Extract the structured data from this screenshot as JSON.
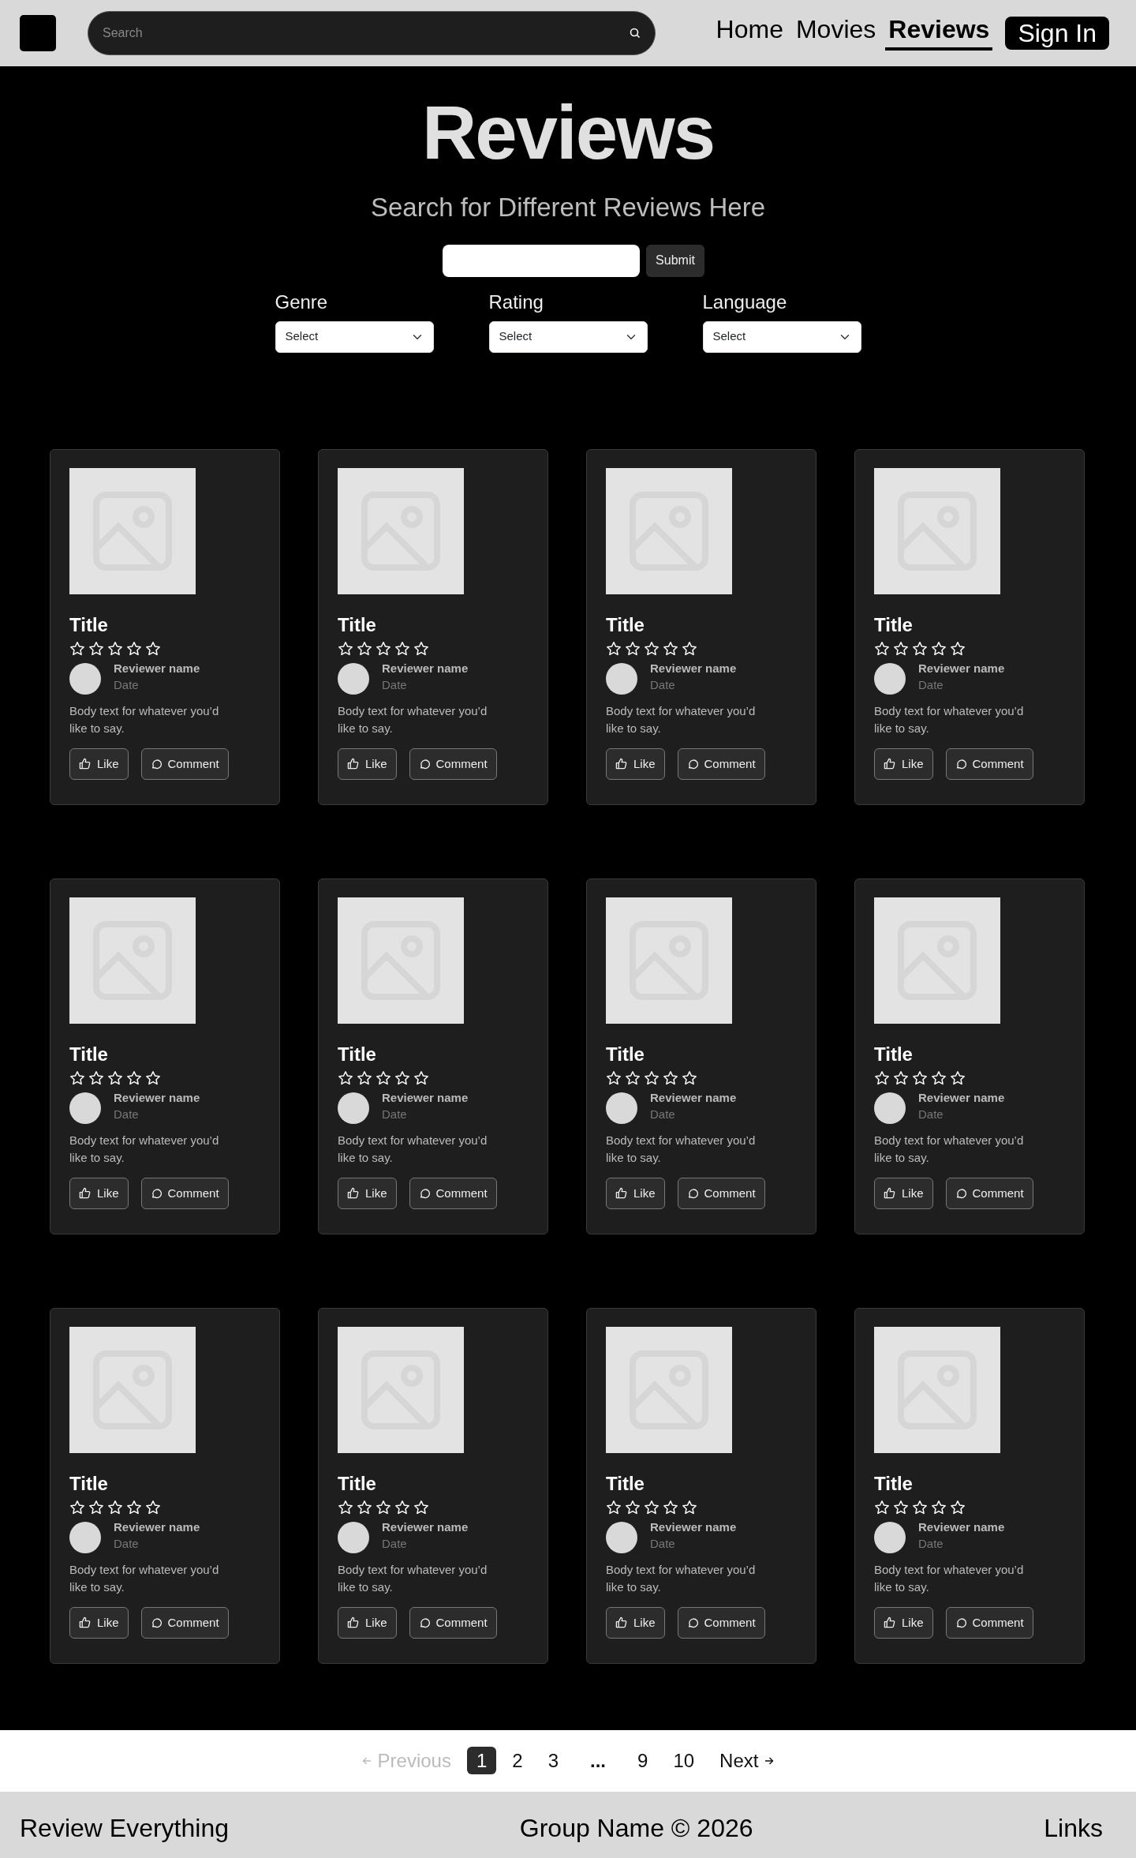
{
  "header": {
    "search": {
      "placeholder": "Search"
    },
    "nav": [
      {
        "label": "Home",
        "selected": false
      },
      {
        "label": "Movies",
        "selected": false
      },
      {
        "label": "Reviews",
        "selected": true
      }
    ],
    "sign_in": "Sign In"
  },
  "hero": {
    "title": "Reviews",
    "subtitle": "Search for Different Reviews Here",
    "submit": "Submit"
  },
  "filters": [
    {
      "label": "Genre",
      "value": "Select"
    },
    {
      "label": "Rating",
      "value": "Select"
    },
    {
      "label": "Language",
      "value": "Select"
    }
  ],
  "cards": [
    {
      "title": "Title",
      "stars": 0,
      "reviewer": "Reviewer name",
      "date": "Date",
      "body": "Body text for whatever you’d like to say.",
      "like": "Like",
      "comment": "Comment"
    },
    {
      "title": "Title",
      "stars": 0,
      "reviewer": "Reviewer name",
      "date": "Date",
      "body": "Body text for whatever you’d like to say.",
      "like": "Like",
      "comment": "Comment"
    },
    {
      "title": "Title",
      "stars": 0,
      "reviewer": "Reviewer name",
      "date": "Date",
      "body": "Body text for whatever you’d like to say.",
      "like": "Like",
      "comment": "Comment"
    },
    {
      "title": "Title",
      "stars": 0,
      "reviewer": "Reviewer name",
      "date": "Date",
      "body": "Body text for whatever you’d like to say.",
      "like": "Like",
      "comment": "Comment"
    },
    {
      "title": "Title",
      "stars": 0,
      "reviewer": "Reviewer name",
      "date": "Date",
      "body": "Body text for whatever you’d like to say.",
      "like": "Like",
      "comment": "Comment"
    },
    {
      "title": "Title",
      "stars": 0,
      "reviewer": "Reviewer name",
      "date": "Date",
      "body": "Body text for whatever you’d like to say.",
      "like": "Like",
      "comment": "Comment"
    },
    {
      "title": "Title",
      "stars": 0,
      "reviewer": "Reviewer name",
      "date": "Date",
      "body": "Body text for whatever you’d like to say.",
      "like": "Like",
      "comment": "Comment"
    },
    {
      "title": "Title",
      "stars": 0,
      "reviewer": "Reviewer name",
      "date": "Date",
      "body": "Body text for whatever you’d like to say.",
      "like": "Like",
      "comment": "Comment"
    },
    {
      "title": "Title",
      "stars": 0,
      "reviewer": "Reviewer name",
      "date": "Date",
      "body": "Body text for whatever you’d like to say.",
      "like": "Like",
      "comment": "Comment"
    },
    {
      "title": "Title",
      "stars": 0,
      "reviewer": "Reviewer name",
      "date": "Date",
      "body": "Body text for whatever you’d like to say.",
      "like": "Like",
      "comment": "Comment"
    },
    {
      "title": "Title",
      "stars": 0,
      "reviewer": "Reviewer name",
      "date": "Date",
      "body": "Body text for whatever you’d like to say.",
      "like": "Like",
      "comment": "Comment"
    },
    {
      "title": "Title",
      "stars": 0,
      "reviewer": "Reviewer name",
      "date": "Date",
      "body": "Body text for whatever you’d like to say.",
      "like": "Like",
      "comment": "Comment"
    }
  ],
  "pagination": {
    "previous": {
      "label": "Previous",
      "disabled": true
    },
    "pages_start": [
      {
        "label": "1",
        "selected": true
      },
      {
        "label": "2",
        "selected": false
      },
      {
        "label": "3",
        "selected": false
      }
    ],
    "ellipsis": "...",
    "pages_end": [
      {
        "label": "9",
        "selected": false
      },
      {
        "label": "10",
        "selected": false
      }
    ],
    "next": {
      "label": "Next",
      "disabled": false
    }
  },
  "footer": {
    "left": "Review Everything",
    "center": "Group Name © 2026",
    "right": "Links"
  }
}
